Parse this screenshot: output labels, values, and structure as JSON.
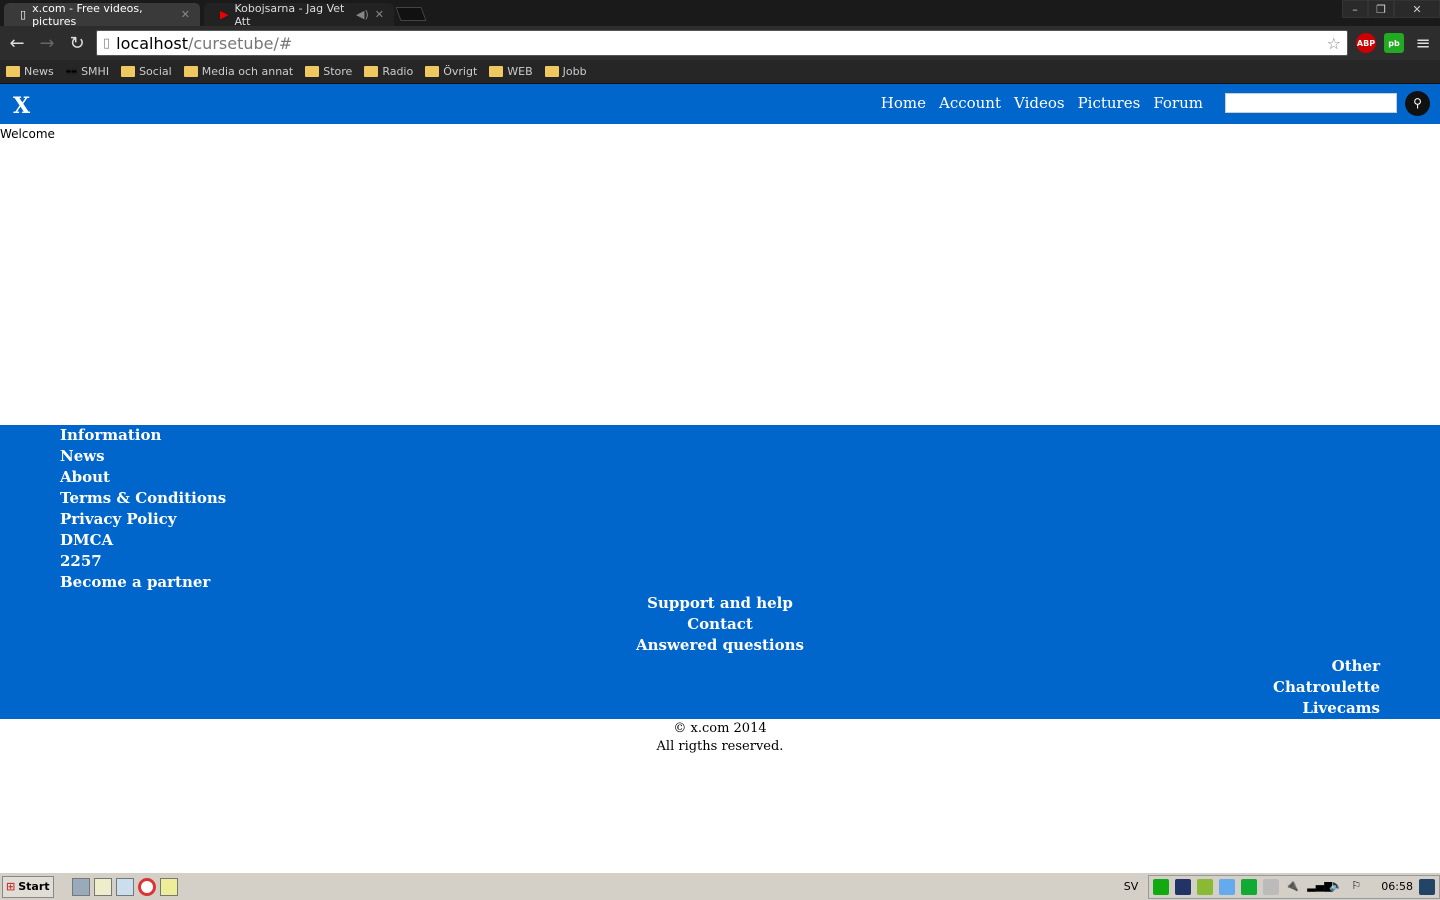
{
  "browser": {
    "tabs": [
      {
        "title": "x.com - Free videos, pictures"
      },
      {
        "title": "Kobojsarna - Jag Vet Att"
      }
    ],
    "url_host": "localhost",
    "url_path": "/cursetube/#",
    "bookmarks": [
      "News",
      "SMHI",
      "Social",
      "Media och annat",
      "Store",
      "Radio",
      "Övrigt",
      "WEB",
      "Jobb"
    ],
    "extensions": [
      "ABP",
      "pb"
    ]
  },
  "site": {
    "logo": "X",
    "menu": [
      "Home",
      "Account",
      "Videos",
      "Pictures",
      "Forum"
    ],
    "search_placeholder": "",
    "welcome": "Welcome"
  },
  "footer": {
    "information": [
      "Information",
      "News",
      "About",
      "Terms & Conditions",
      "Privacy Policy",
      "DMCA",
      "2257",
      "Become a partner"
    ],
    "support": [
      "Support and help",
      "Contact",
      "Answered questions"
    ],
    "other": [
      "Other",
      "Chatroulette",
      "Livecams"
    ],
    "copyright": "© x.com 2014",
    "rights": "All rigths reserved."
  },
  "taskbar": {
    "start": "Start",
    "lang": "SV",
    "clock": "06:58"
  }
}
